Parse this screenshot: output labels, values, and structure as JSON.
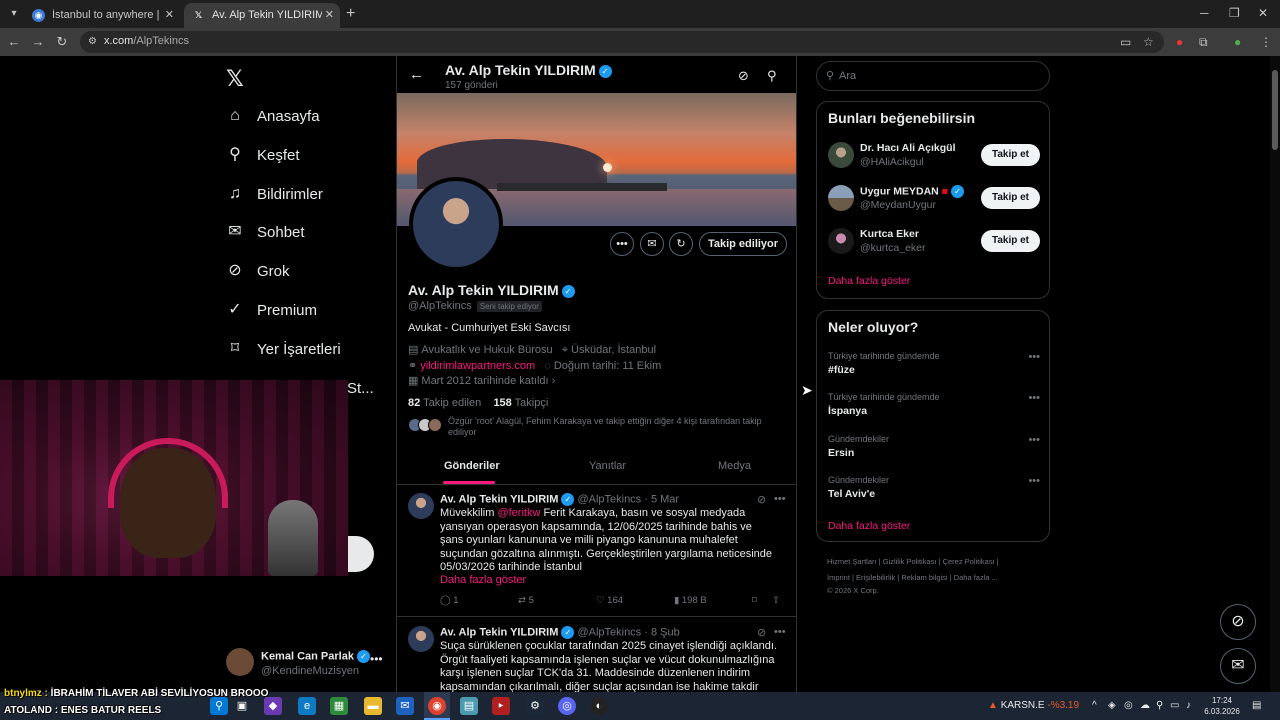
{
  "browser": {
    "tabs": [
      {
        "title": "İstanbul to anywhere | Explore",
        "active": false
      },
      {
        "title": "Av. Alp Tekin YILDIRIM (@AlpTe",
        "active": true
      }
    ],
    "url_domain": "x.com",
    "url_path": "/AlpTekincs"
  },
  "nav": {
    "items": [
      {
        "label": "Anasayfa",
        "icon": "home-icon"
      },
      {
        "label": "Keşfet",
        "icon": "search-icon"
      },
      {
        "label": "Bildirimler",
        "icon": "bell-icon"
      },
      {
        "label": "Sohbet",
        "icon": "mail-icon"
      },
      {
        "label": "Grok",
        "icon": "grok-icon"
      },
      {
        "label": "Premium",
        "icon": "premium-icon"
      },
      {
        "label": "Yer İşaretleri",
        "icon": "bookmark-icon"
      }
    ],
    "more_partial": "St...",
    "account": {
      "name": "Kemal Can Parlak",
      "handle": "@KendineMuzisyen"
    }
  },
  "profile_header": {
    "name": "Av. Alp Tekin YILDIRIM",
    "posts_count": "157 gönderi"
  },
  "profile": {
    "name": "Av. Alp Tekin YILDIRIM",
    "handle": "@AlpTekincs",
    "follows_you": "Seni takip ediyor",
    "bio": "Avukat - Cumhuriyet Eski Savcısı",
    "category": "Avukatlık ve Hukuk Bürosu",
    "location": "Üsküdar, İstanbul",
    "website": "yildirimlawpartners.com",
    "birthday": "Doğum tarihi: 11 Ekim",
    "joined": "Mart 2012 tarihinde katıldı",
    "following_count": "82",
    "following_label": "Takip edilen",
    "followers_count": "158",
    "followers_label": "Takipçi",
    "known_followers": "Özgür 'root' Alagül, Fehim Karakaya ve takip ettiğin diğer 4 kişi tarafından takip ediliyor",
    "follow_button": "Takip ediliyor"
  },
  "tabs": [
    {
      "label": "Gönderiler",
      "active": true
    },
    {
      "label": "Yanıtlar",
      "active": false
    },
    {
      "label": "Medya",
      "active": false
    }
  ],
  "posts": [
    {
      "author": "Av. Alp Tekin YILDIRIM",
      "handle": "@AlpTekincs",
      "date": "· 5 Mar",
      "text_pre": "Müvekkilim ",
      "mention": "@feritkw",
      "text_post": " Ferit Karakaya, basın ve sosyal medyada yansıyan operasyon kapsamında, 12/06/2025 tarihinde bahis ve şans oyunları kanununa ve milli piyango kanununa muhalefet suçundan gözaltına alınmıştı. Gerçekleştirilen yargılama neticesinde 05/03/2026 tarihinde İstanbul",
      "show_more": "Daha fazla göster",
      "replies": "1",
      "reposts": "5",
      "likes": "164",
      "views": "198 B"
    },
    {
      "author": "Av. Alp Tekin YILDIRIM",
      "handle": "@AlpTekincs",
      "date": "· 8 Şub",
      "text": "Suça sürüklenen çocuklar tarafından 2025 cinayet işlendiği açıklandı. Örgüt faaliyeti kapsamında işlenen suçlar ve vücut dokunulmazlığına karşı işlenen suçlar TCK'da 31. Maddesinde düzenlenen indirim kapsamından çıkarılmalı, diğer suçlar açısından ise hakime takdir hakkı"
    }
  ],
  "search": {
    "placeholder": "Ara"
  },
  "who_to_follow": {
    "title": "Bunları beğenebilirsin",
    "users": [
      {
        "name": "Dr. Hacı Ali Açıkgül",
        "handle": "@HAliAcikgul",
        "button": "Takip et",
        "flag": false,
        "verified": false
      },
      {
        "name": "Uygur MEYDAN",
        "handle": "@MeydanUygur",
        "button": "Takip et",
        "flag": true,
        "verified": true
      },
      {
        "name": "Kurtca Eker",
        "handle": "@kurtca_eker",
        "button": "Takip et",
        "flag": false,
        "verified": false
      }
    ],
    "show_more": "Daha fazla göster"
  },
  "trends": {
    "title": "Neler oluyor?",
    "items": [
      {
        "category": "Türkiye tarihinde gündemde",
        "name": "#füze"
      },
      {
        "category": "Türkiye tarihinde gündemde",
        "name": "İspanya"
      },
      {
        "category": "Gündemdekiler",
        "name": "Ersin"
      },
      {
        "category": "Gündemdekiler",
        "name": "Tel Aviv'e"
      }
    ],
    "show_more": "Daha fazla göster"
  },
  "footer": {
    "links_row1": "Hizmet Şartları  |  Gizlilik Politikası  |  Çerez Politikası  |",
    "links_row2": "İmprint  |  Erişilebilirlik  |  Reklam bilgisi  |  Daha fazla ...",
    "copyright": "© 2026 X Corp."
  },
  "overlay": {
    "line1_user": "btnylmz :",
    "line1_text": " İBRAHİM TİLAVER ABİ SEVİLİYOSUN BROOO",
    "line2": "ATOLAND : ENES BATUR REELS"
  },
  "taskbar": {
    "stock_name": "KARSN.E",
    "stock_change": "-%3.19",
    "time": "17:24",
    "date": "6.03.2026"
  },
  "colors": {
    "accent": "#f91880",
    "verified": "#1d9bf0",
    "bg": "#000000"
  }
}
